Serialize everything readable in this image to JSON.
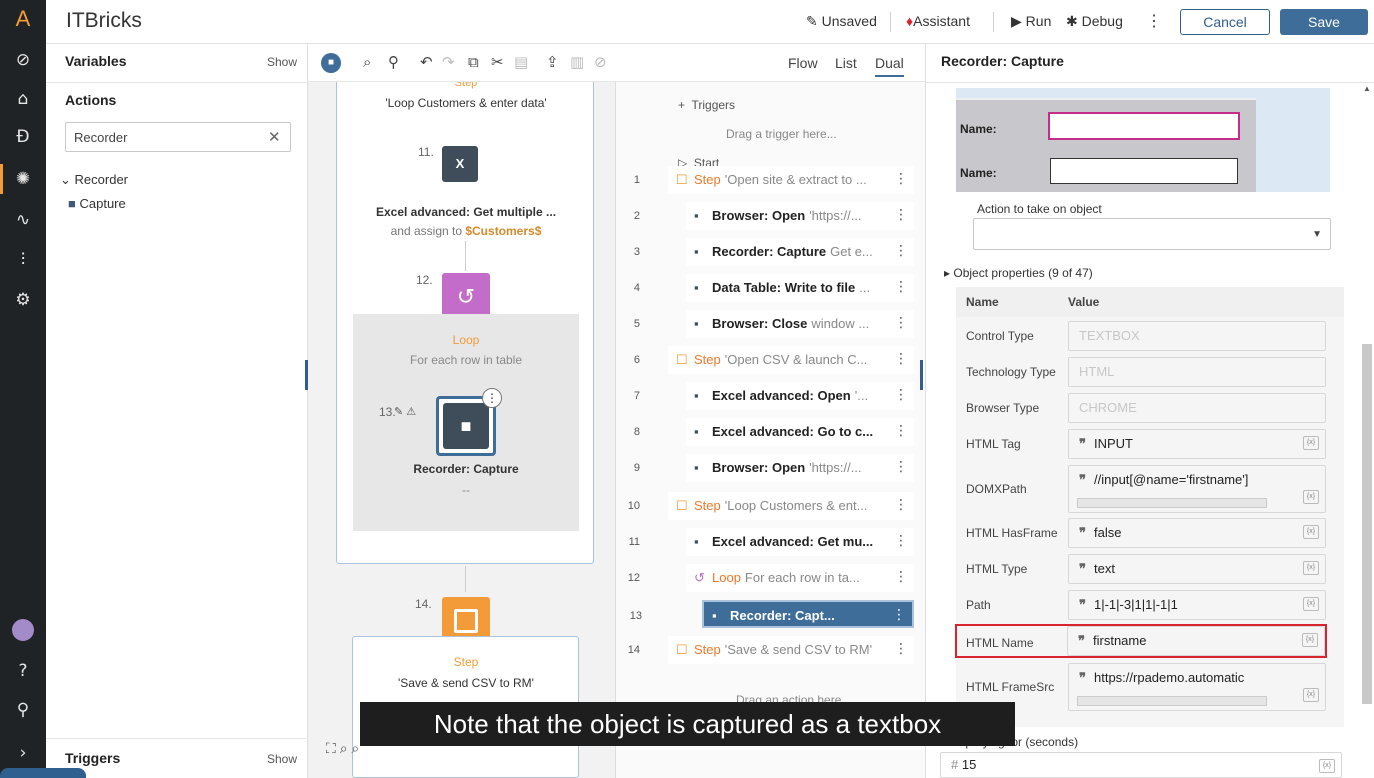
{
  "app": {
    "logo_glyph": "A",
    "title": "ITBricks"
  },
  "header": {
    "unsaved": "Unsaved",
    "assistant": "Assistant",
    "run": "Run",
    "debug": "Debug",
    "cancel": "Cancel",
    "save": "Save"
  },
  "variables_panel": {
    "variables": "Variables",
    "show": "Show",
    "actions": "Actions",
    "search_value": "Recorder",
    "tree_group": "Recorder",
    "tree_item": "Capture",
    "triggers": "Triggers",
    "triggers_show": "Show"
  },
  "flow_tabs": {
    "flow": "Flow",
    "list": "List",
    "dual": "Dual"
  },
  "flow": {
    "step_top_label": "Step",
    "step_top_title": "'Loop Customers & enter data'",
    "n11": "11.",
    "a11_title": "Excel advanced: Get multiple ...",
    "a11_sub_prefix": "and assign to ",
    "a11_var": "$Customers$",
    "n12": "12.",
    "loop_label": "Loop",
    "loop_sub": "For each row in table",
    "n13": "13.",
    "rec_title": "Recorder: Capture",
    "rec_sub": "--",
    "n14": "14.",
    "step_label": "Step",
    "step14_title": "'Save & send CSV to RM'"
  },
  "list": {
    "triggers": "Triggers",
    "drag_trigger": "Drag a trigger here...",
    "start": "Start",
    "rows": [
      {
        "n": "1",
        "kind": "Step",
        "text": "'Open site & extract to ..."
      },
      {
        "n": "2",
        "kind": "Browser: Open",
        "text": "'https://..."
      },
      {
        "n": "3",
        "kind": "Recorder: Capture",
        "text": "Get e..."
      },
      {
        "n": "4",
        "kind": "Data Table: Write to file",
        "text": "..."
      },
      {
        "n": "5",
        "kind": "Browser: Close",
        "text": "window ..."
      },
      {
        "n": "6",
        "kind": "Step",
        "text": "'Open CSV & launch C..."
      },
      {
        "n": "7",
        "kind": "Excel advanced: Open",
        "text": "'..."
      },
      {
        "n": "8",
        "kind": "Excel advanced: Go to c...",
        "text": ""
      },
      {
        "n": "9",
        "kind": "Browser: Open",
        "text": "'https://..."
      },
      {
        "n": "10",
        "kind": "Step",
        "text": "'Loop Customers & ent..."
      },
      {
        "n": "11",
        "kind": "Excel advanced: Get mu...",
        "text": ""
      },
      {
        "n": "12",
        "kind": "Loop",
        "text": "For each row in ta..."
      },
      {
        "n": "13",
        "kind": "Recorder: Capt...",
        "text": ""
      },
      {
        "n": "14",
        "kind": "Step",
        "text": "'Save & send CSV to RM'"
      }
    ],
    "drag_action": "Drag an action here..."
  },
  "props": {
    "panel_title": "Recorder: Capture",
    "preview_label1": "Name:",
    "preview_label2": "Name:",
    "action_label": "Action to take on object",
    "obj_props": "Object properties (9 of 47)",
    "col_name": "Name",
    "col_value": "Value",
    "rows": [
      {
        "name": "Control Type",
        "value": "TEXTBOX"
      },
      {
        "name": "Technology Type",
        "value": "HTML"
      },
      {
        "name": "Browser Type",
        "value": "CHROME"
      },
      {
        "name": "HTML Tag",
        "value": "INPUT"
      },
      {
        "name": "DOMXPath",
        "value": "//input[@name='firstname']"
      },
      {
        "name": "HTML HasFrame",
        "value": "false"
      },
      {
        "name": "HTML Type",
        "value": "text"
      },
      {
        "name": "Path",
        "value": "1|-1|-3|1|1|-1|1"
      },
      {
        "name": "HTML Name",
        "value": "firstname"
      },
      {
        "name": "HTML FrameSrc",
        "value": "https://rpademo.automatic"
      }
    ],
    "keep_trying": "Keep trying for (seconds)",
    "keep_value": "15"
  },
  "caption": "Note that the object is captured as a textbox",
  "colors": {
    "accent": "#3d6d98",
    "orange": "#f29b38",
    "highlight": "#d9232e",
    "loop": "#c46cc9"
  }
}
